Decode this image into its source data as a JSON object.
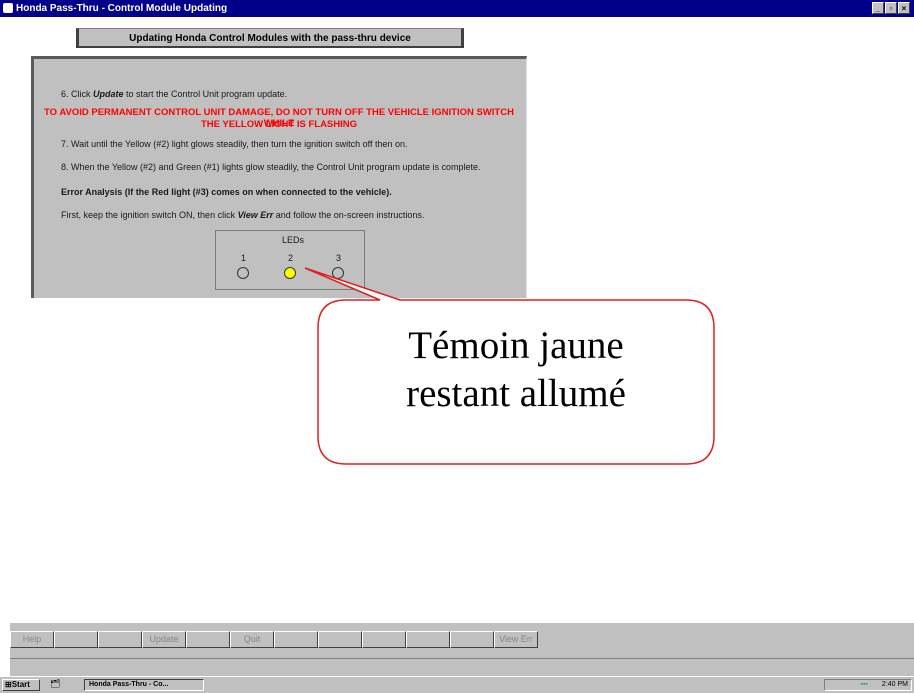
{
  "window": {
    "title": "Honda Pass-Thru - Control Module Updating",
    "controls": [
      "_",
      "▫",
      "×"
    ]
  },
  "header": {
    "title": "Updating Honda Control Modules with the pass-thru device"
  },
  "instructions": {
    "step6_prefix": "6. Click ",
    "step6_link": "Update",
    "step6_suffix": " to start the Control Unit program update.",
    "warning_line1": "TO AVOID PERMANENT CONTROL UNIT DAMAGE, DO NOT TURN OFF THE VEHICLE IGNITION SWITCH WHILE",
    "warning_line2": "THE YELLOW LIGHT IS FLASHING",
    "step7": "7. Wait until the Yellow (#2) light glows steadily, then turn the ignition switch off then on.",
    "step8": "8. When the Yellow (#2) and Green (#1) lights glow steadily, the Control Unit program update is complete.",
    "error_heading": "Error Analysis (If the Red light (#3) comes on when connected to the vehicle).",
    "error_prefix": "First, keep the ignition switch ON, then click ",
    "error_link": "View Err",
    "error_suffix": " and follow the on-screen instructions."
  },
  "leds": {
    "title": "LEDs",
    "items": [
      {
        "label": "1",
        "color": "#c0c0c0"
      },
      {
        "label": "2",
        "color": "#ffff00"
      },
      {
        "label": "3",
        "color": "#c0c0c0"
      }
    ]
  },
  "callout": {
    "line1": "Témoin jaune",
    "line2": "restant allumé",
    "border_color": "#e02020"
  },
  "toolbar": {
    "help": "Help",
    "update": "Update",
    "quit": "Quit",
    "view_err": "View Err"
  },
  "taskbar": {
    "start": "Start",
    "task": "Honda Pass-Thru - Co...",
    "clock": "2:40 PM"
  }
}
